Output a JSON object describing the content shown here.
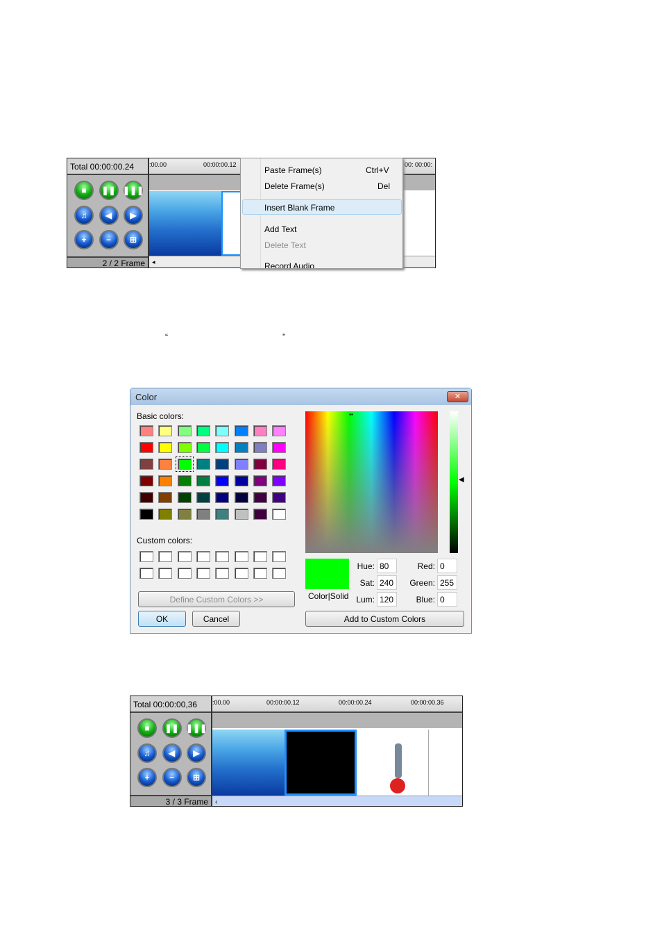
{
  "timeline1": {
    "total": "Total 00:00:00.24",
    "frame_count": "2 / 2 Frame",
    "ticks": [
      ":00.00",
      "00:00:00.12"
    ],
    "right_ticks": "00:   00:00:"
  },
  "context_menu": {
    "items": [
      {
        "label": "Paste Frame(s)",
        "shortcut": "Ctrl+V",
        "enabled": true
      },
      {
        "label": "Delete Frame(s)",
        "shortcut": "Del",
        "enabled": true
      },
      {
        "label": "Insert Blank Frame",
        "shortcut": "",
        "enabled": true,
        "highlighted": true
      },
      {
        "label": "Add Text",
        "shortcut": "",
        "enabled": true
      },
      {
        "label": "Delete Text",
        "shortcut": "",
        "enabled": false
      },
      {
        "label": "Record Audio",
        "shortcut": "",
        "enabled": true
      }
    ]
  },
  "quotes": {
    "open": "“",
    "close": "”"
  },
  "color_dialog": {
    "title": "Color",
    "basic_label": "Basic colors:",
    "custom_label": "Custom colors:",
    "basic_colors": [
      "#FF8080",
      "#FFFF80",
      "#80FF80",
      "#00FF80",
      "#80FFFF",
      "#0080FF",
      "#FF80C0",
      "#FF80FF",
      "#FF0000",
      "#FFFF00",
      "#80FF00",
      "#00FF40",
      "#00FFFF",
      "#0080C0",
      "#8080C0",
      "#FF00FF",
      "#804040",
      "#FF8040",
      "#00FF00",
      "#008080",
      "#004080",
      "#8080FF",
      "#800040",
      "#FF0080",
      "#800000",
      "#FF8000",
      "#008000",
      "#008040",
      "#0000FF",
      "#0000A0",
      "#800080",
      "#8000FF",
      "#400000",
      "#804000",
      "#004000",
      "#004040",
      "#000080",
      "#000040",
      "#400040",
      "#400080",
      "#000000",
      "#808000",
      "#808040",
      "#808080",
      "#408080",
      "#C0C0C0",
      "#400040",
      "#FFFFFF"
    ],
    "selected_index": 18,
    "define_custom": "Define Custom Colors >>",
    "ok": "OK",
    "cancel": "Cancel",
    "add_custom": "Add to Custom Colors",
    "color_solid": "Color|Solid",
    "hue_label": "Hue:",
    "sat_label": "Sat:",
    "lum_label": "Lum:",
    "red_label": "Red:",
    "green_label": "Green:",
    "blue_label": "Blue:",
    "hue": "80",
    "sat": "240",
    "lum": "120",
    "red": "0",
    "green": "255",
    "blue": "0",
    "current_color": "#00FF00"
  },
  "timeline2": {
    "total": "Total 00:00:00,36",
    "frame_count": "3 / 3 Frame",
    "ticks": [
      ":00.00",
      "00:00:00.12",
      "00:00:00.24",
      "00:00:00.36"
    ]
  }
}
